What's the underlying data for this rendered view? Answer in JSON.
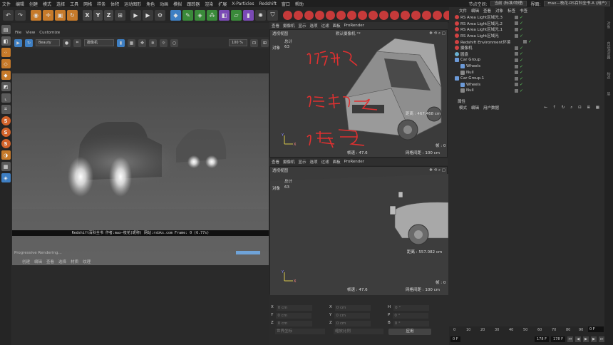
{
  "menubar": {
    "items": [
      "文件",
      "编辑",
      "创建",
      "模式",
      "选择",
      "工具",
      "网格",
      "样条",
      "体积",
      "运动图形",
      "角色",
      "动画",
      "模拟",
      "跟踪器",
      "渲染",
      "扩展",
      "X-Particles",
      "Redshift",
      "窗口",
      "帮助"
    ],
    "node_space_label": "节点空间:",
    "node_space_value": "当前 (标准/物理)",
    "interface_label": "界面:",
    "interface_value": "max—枝花-RS百科全书-A (用户)"
  },
  "toolbar": {
    "x": "X",
    "y": "Y",
    "z": "Z"
  },
  "render_view": {
    "menu": [
      "File",
      "View",
      "Customize"
    ],
    "preset": "Beauty",
    "camera": "摄像机",
    "zoom": "100 %",
    "caption": "Redshift百科全书  作者:max—枝花(昵称)  网站:rsbks.com  Frame: 0   (6.77s)",
    "progress": "Progressive Rendering..."
  },
  "bottom_menu": [
    "创建",
    "编辑",
    "查看",
    "选择",
    "材质",
    "纹理"
  ],
  "viewport_top": {
    "menu": [
      "查看",
      "摄像机",
      "显示",
      "选项",
      "过滤",
      "面板",
      "ProRender"
    ],
    "title": "透视视图",
    "camera": "默认摄像机 °*",
    "total": "总计",
    "objects_label": "对象",
    "objects": "63",
    "distance": "距离 : 467.468 cm",
    "fps": "帧速 : 47.6",
    "frame": "帧 : 0",
    "grid": "网格间距 : 100 cm"
  },
  "annotations": [
    "①环境",
    "②灯光",
    "③雾气"
  ],
  "viewport_bot": {
    "menu": [
      "查看",
      "摄像机",
      "显示",
      "选项",
      "过滤",
      "面板",
      "ProRender"
    ],
    "title": "透视视图",
    "total": "总计",
    "objects_label": "对象",
    "objects": "63",
    "distance": "距离 : 557.082 cm",
    "fps": "帧速 : 47.6",
    "frame": "帧 : 0",
    "grid": "网格间距 : 100 cm"
  },
  "coords": {
    "rows": [
      [
        "X",
        "0 cm",
        "X",
        "0 cm",
        "H",
        "0 °"
      ],
      [
        "Y",
        "0 cm",
        "Y",
        "0 cm",
        "P",
        "0 °"
      ],
      [
        "Z",
        "0 cm",
        "Z",
        "0 cm",
        "B",
        "0 °"
      ]
    ],
    "mode1": "世界坐标",
    "mode2": "缩放比例",
    "apply": "应用"
  },
  "objects_panel": {
    "menu": [
      "文件",
      "编辑",
      "查看",
      "对象",
      "标签",
      "书签"
    ],
    "items": [
      {
        "name": "RS Area Light区域光.3",
        "type": "light"
      },
      {
        "name": "RS Area Light区域光.2",
        "type": "light"
      },
      {
        "name": "RS Area Light区域光.1",
        "type": "light"
      },
      {
        "name": "RS Area Light区域光",
        "type": "light"
      },
      {
        "name": "Redshift Environment环境",
        "type": "light"
      },
      {
        "name": "摄像机",
        "type": "light"
      },
      {
        "name": "圆盘",
        "type": "light"
      },
      {
        "name": "Car Group",
        "type": "group"
      },
      {
        "name": "Wheels",
        "type": "group"
      },
      {
        "name": "Null",
        "type": "null"
      },
      {
        "name": "Car Group.1",
        "type": "group"
      },
      {
        "name": "Wheels",
        "type": "group"
      },
      {
        "name": "Null",
        "type": "null"
      }
    ]
  },
  "attributes_panel": {
    "tab": "属性",
    "menu": [
      "模式",
      "编辑",
      "用户数据"
    ]
  },
  "timeline": {
    "ticks": [
      "0",
      "10",
      "20",
      "30",
      "40",
      "50",
      "60",
      "70",
      "80",
      "90"
    ],
    "current": "0 F",
    "start": "0 F",
    "end": "178 F",
    "end2": "178 F"
  },
  "right_strip": [
    "对象",
    "内容浏览器",
    "构造",
    "层"
  ]
}
